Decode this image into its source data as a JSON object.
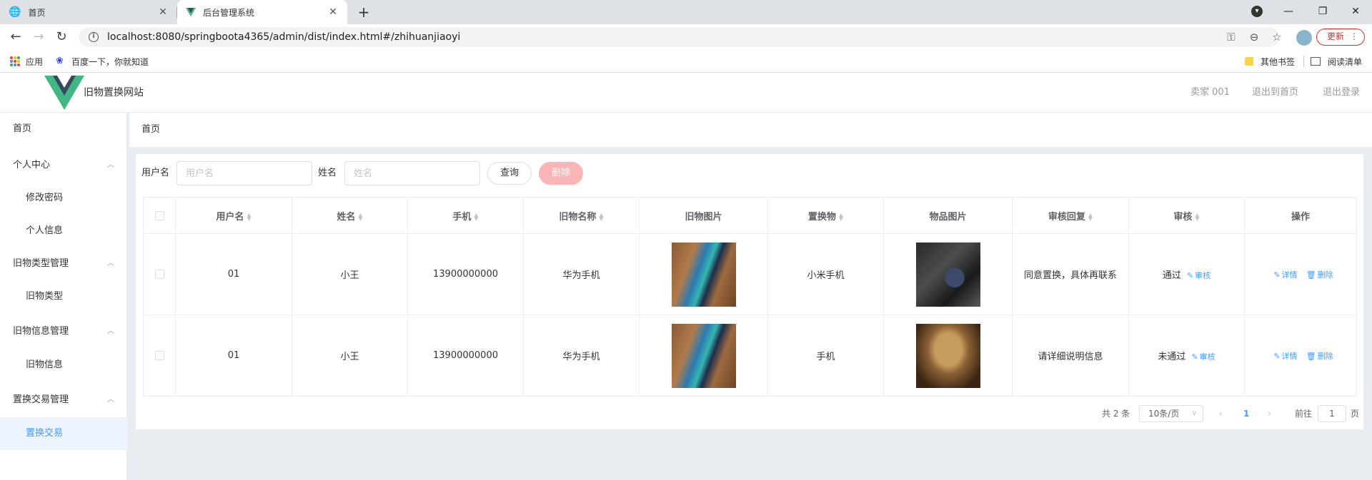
{
  "browser": {
    "tabs": [
      {
        "title": "首页",
        "active": false
      },
      {
        "title": "后台管理系统",
        "active": true
      }
    ],
    "url": "localhost:8080/springboota4365/admin/dist/index.html#/zhihuanjiaoyi",
    "update_label": "更新",
    "bookmarks": {
      "apps": "应用",
      "baidu": "百度一下，你就知道",
      "other": "其他书签",
      "reading_list": "阅读清单"
    }
  },
  "header": {
    "site_title": "旧物置换网站",
    "user": "卖家 001",
    "back_home": "退出到首页",
    "logout": "退出登录"
  },
  "sidebar": {
    "items": [
      {
        "label": "首页",
        "type": "top"
      },
      {
        "label": "个人中心",
        "type": "group"
      },
      {
        "label": "修改密码",
        "type": "sub"
      },
      {
        "label": "个人信息",
        "type": "sub"
      },
      {
        "label": "旧物类型管理",
        "type": "group"
      },
      {
        "label": "旧物类型",
        "type": "sub"
      },
      {
        "label": "旧物信息管理",
        "type": "group"
      },
      {
        "label": "旧物信息",
        "type": "sub"
      },
      {
        "label": "置换交易管理",
        "type": "group"
      },
      {
        "label": "置换交易",
        "type": "sub",
        "active": true
      }
    ]
  },
  "breadcrumb": "首页",
  "filter": {
    "username_label": "用户名",
    "username_placeholder": "用户名",
    "name_label": "姓名",
    "name_placeholder": "姓名",
    "query_label": "查询",
    "delete_label": "删除"
  },
  "table": {
    "headers": [
      "用户名",
      "姓名",
      "手机",
      "旧物名称",
      "旧物图片",
      "置换物",
      "物品图片",
      "审核回复",
      "审核",
      "操作"
    ],
    "rows": [
      {
        "username": "01",
        "name": "小王",
        "phone": "13900000000",
        "item": "华为手机",
        "exchange": "小米手机",
        "reply": "同意置换，具体再联系",
        "status": "通过"
      },
      {
        "username": "01",
        "name": "小王",
        "phone": "13900000000",
        "item": "华为手机",
        "exchange": "手机",
        "reply": "请详细说明信息",
        "status": "未通过"
      }
    ],
    "audit_link": "审核",
    "detail_link": "详情",
    "delete_link": "删除"
  },
  "pagination": {
    "total": "共 2 条",
    "page_size": "10条/页",
    "current_page": "1",
    "goto_label": "前往",
    "goto_value": "1",
    "page_suffix": "页"
  }
}
